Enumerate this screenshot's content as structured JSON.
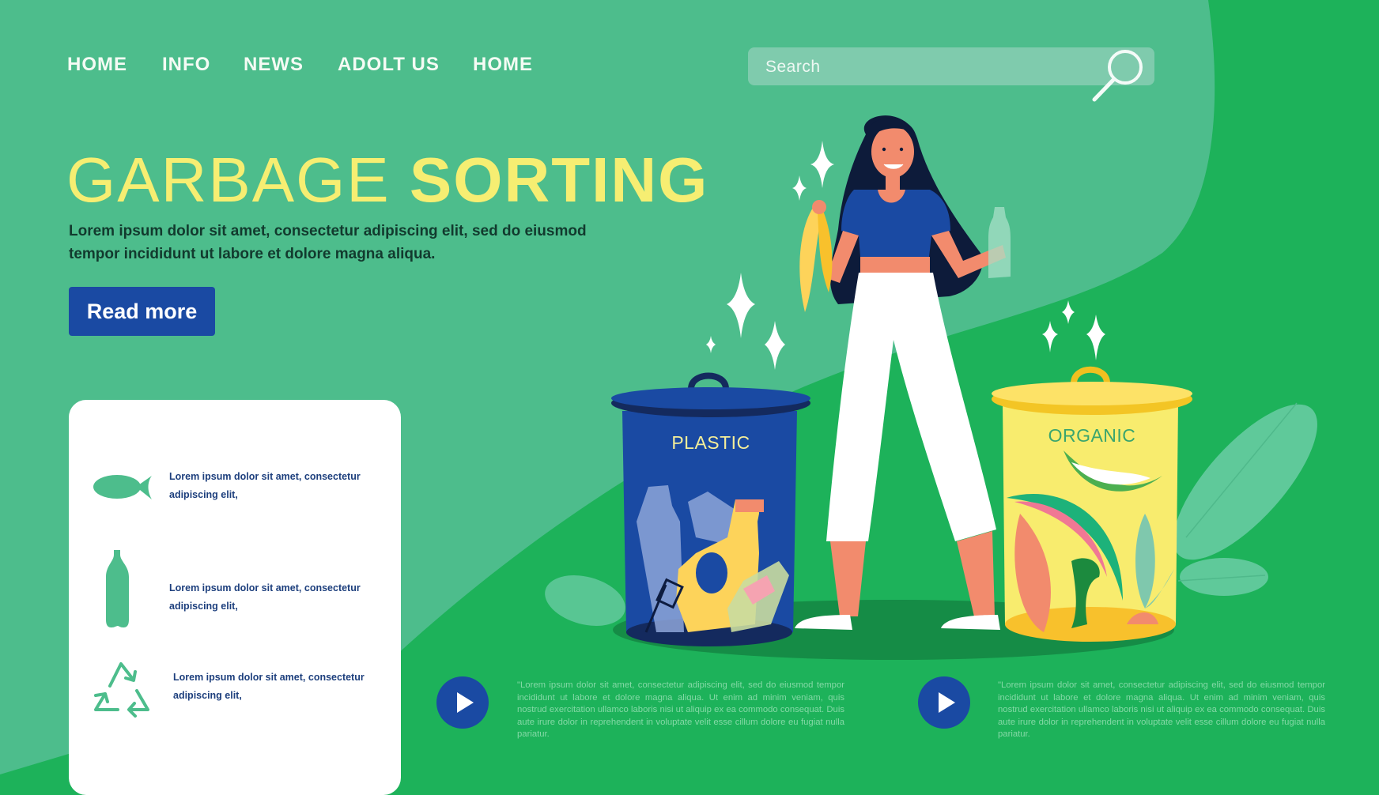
{
  "nav": {
    "items": [
      {
        "label": "HOME"
      },
      {
        "label": "INFO"
      },
      {
        "label": "NEWS"
      },
      {
        "label": "ADOLT US"
      },
      {
        "label": "HOME"
      }
    ]
  },
  "search": {
    "placeholder": "Search",
    "value": "",
    "icon": "search-icon"
  },
  "hero": {
    "title_light": "GARBAGE",
    "title_bold": "SORTING",
    "lead": "Lorem ipsum dolor sit amet, consectetur adipiscing elit, sed do eiusmod tempor incididunt ut labore et dolore magna aliqua.",
    "button_label": "Read more"
  },
  "features": [
    {
      "icon": "fish-icon",
      "text": "Lorem ipsum dolor sit amet, consectetur adipiscing elit,"
    },
    {
      "icon": "bottle-icon",
      "text": "Lorem ipsum dolor sit amet, consectetur adipiscing elit,"
    },
    {
      "icon": "recycle-icon",
      "text": "Lorem ipsum dolor sit amet, consectetur adipiscing elit,"
    }
  ],
  "notes": [
    {
      "icon": "play-icon",
      "text": "\"Lorem ipsum dolor sit amet, consectetur adipiscing elit, sed do eiusmod tempor incididunt ut labore et dolore magna aliqua. Ut enim ad minim veniam, quis nostrud exercitation ullamco laboris nisi ut aliquip ex ea commodo consequat. Duis aute irure dolor in reprehendent in voluptate velit esse cillum dolore eu fugiat nulla pariatur."
    },
    {
      "icon": "play-icon",
      "text": "\"Lorem ipsum dolor sit amet, consectetur adipiscing elit, sed do eiusmod tempor incididunt ut labore et dolore magna aliqua. Ut enim ad minim veniam, quis nostrud exercitation ullamco laboris nisi ut aliquip ex ea commodo consequat. Duis aute irure dolor in reprehendent in voluptate velit esse cillum dolore eu fugiat nulla pariatur."
    }
  ],
  "illustration": {
    "bins": [
      {
        "label": "PLASTIC",
        "color": "#1a4aa3",
        "label_color": "#f4ee9a"
      },
      {
        "label": "ORGANIC",
        "color": "#f8ec6e",
        "label_color": "#3aa56e"
      }
    ]
  },
  "colors": {
    "background": "#1db25a",
    "blob": "#4dbd8c",
    "accent_yellow": "#f6ee72",
    "accent_blue": "#1a4aa3"
  }
}
